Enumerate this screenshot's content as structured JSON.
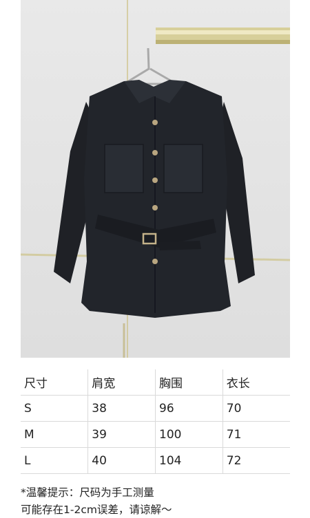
{
  "product_image": {
    "subject": "garment-photo"
  },
  "size_table": {
    "headers": [
      "尺寸",
      "肩宽",
      "胸围",
      "衣长"
    ],
    "rows": [
      [
        "S",
        "38",
        "96",
        "70"
      ],
      [
        "M",
        "39",
        "100",
        "71"
      ],
      [
        "L",
        "40",
        "104",
        "72"
      ]
    ]
  },
  "notes": {
    "line1": "*温馨提示：尺码为手工测量",
    "line2": "可能存在1-2cm误差，请谅解～"
  }
}
